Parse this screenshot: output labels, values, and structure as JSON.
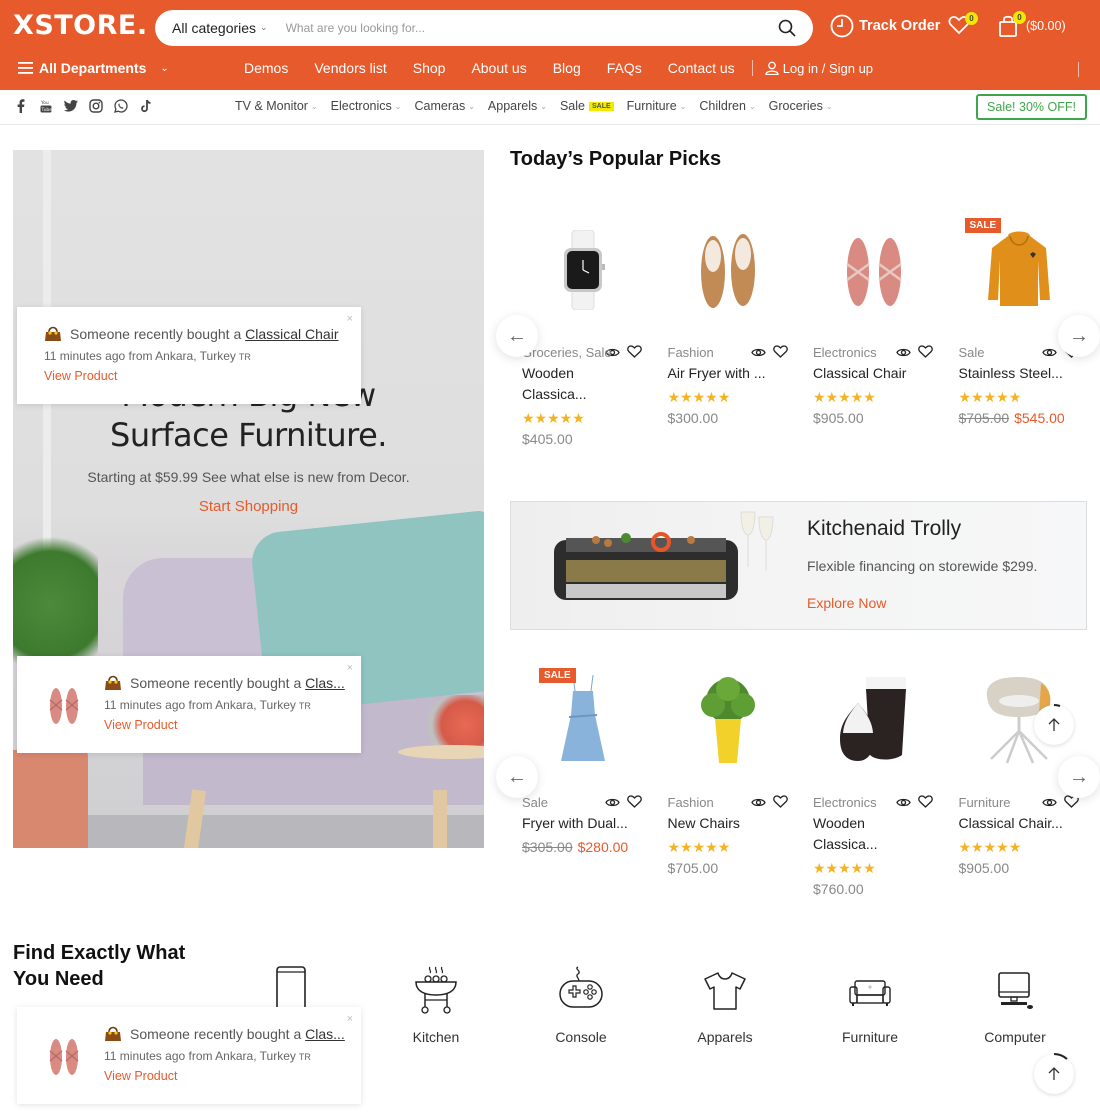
{
  "brand": {
    "logo": "XSTORE.",
    "accent": "#e65a2b",
    "sale_green": "#3ea64a",
    "badge_yellow": "#f2e800",
    "star_color": "#f5b223"
  },
  "header": {
    "search": {
      "category": "All categories",
      "placeholder": "What are you looking for..."
    },
    "track_order": "Track Order",
    "wishlist_count": "0",
    "cart_count": "0",
    "cart_total": "($0.00)",
    "departments": "All Departments",
    "nav": [
      "Demos",
      "Vendors list",
      "Shop",
      "About us",
      "Blog",
      "FAQs",
      "Contact us"
    ],
    "login": "Log in / Sign up"
  },
  "subnav": {
    "socials": [
      "facebook",
      "youtube",
      "twitter",
      "instagram",
      "whatsapp",
      "tiktok"
    ],
    "categories": [
      "TV & Monitor",
      "Electronics",
      "Cameras",
      "Apparels",
      "Sale",
      "Furniture",
      "Children",
      "Groceries"
    ],
    "sale_tag": "SALE",
    "sale_button": "Sale! 30% OFF!"
  },
  "hero": {
    "title_line1": "Modern Big New",
    "title_line2": "Surface Furniture.",
    "subtitle": "Starting at $59.99 See what else is new from Decor.",
    "cta": "Start Shopping"
  },
  "popups": [
    {
      "prefix": "Someone recently bought a",
      "product": "Classical Chair",
      "time": "11 minutes ago from Ankara, Turkey",
      "country": "TR",
      "cta": "View Product",
      "close": "×"
    },
    {
      "prefix": "Someone recently bought a",
      "product": "Clas...",
      "time": "11 minutes ago from Ankara, Turkey",
      "country": "TR",
      "cta": "View Product",
      "close": "×"
    },
    {
      "prefix": "Someone recently bought a",
      "product": "Clas...",
      "time": "11 minutes ago from Ankara, Turkey",
      "country": "TR",
      "cta": "View Product",
      "close": "×"
    }
  ],
  "popular": {
    "title": "Today’s Popular Picks",
    "row1": [
      {
        "category": "Groceries, Sale",
        "name": "Wooden Classica...",
        "rating": 5,
        "price": "$405.00",
        "old_price": null,
        "sale": false,
        "image": "watch"
      },
      {
        "category": "Fashion",
        "name": "Air Fryer with ...",
        "rating": 5,
        "price": "$300.00",
        "old_price": null,
        "sale": false,
        "image": "loafers"
      },
      {
        "category": "Electronics",
        "name": "Classical Chair",
        "rating": 5,
        "price": "$905.00",
        "old_price": null,
        "sale": false,
        "image": "sandals"
      },
      {
        "category": "Sale",
        "name": "Stainless Steel...",
        "rating": 5,
        "price": "$545.00",
        "old_price": "$705.00",
        "sale": true,
        "image": "hoodie"
      }
    ],
    "row2": [
      {
        "category": "Sale",
        "name": "Fryer with Dual...",
        "rating": null,
        "price": "$280.00",
        "old_price": "$305.00",
        "sale": true,
        "image": "dress"
      },
      {
        "category": "Fashion",
        "name": "New Chairs",
        "rating": 5,
        "price": "$705.00",
        "old_price": null,
        "sale": false,
        "image": "plant"
      },
      {
        "category": "Electronics",
        "name": "Wooden Classica...",
        "rating": 5,
        "price": "$760.00",
        "old_price": null,
        "sale": false,
        "image": "vases"
      },
      {
        "category": "Furniture",
        "name": "Classical Chair...",
        "rating": 5,
        "price": "$905.00",
        "old_price": null,
        "sale": false,
        "image": "chair"
      }
    ],
    "sale_badge": "SALE",
    "stars_text": "★★★★★"
  },
  "promo": {
    "title": "Kitchenaid Trolly",
    "subtitle": "Flexible financing on storewide $299.",
    "cta": "Explore Now"
  },
  "find": {
    "title_line1": "Find Exactly What",
    "title_line2": "You Need",
    "categories": [
      "Phones",
      "Kitchen",
      "Console",
      "Apparels",
      "Furniture",
      "Computer"
    ]
  }
}
